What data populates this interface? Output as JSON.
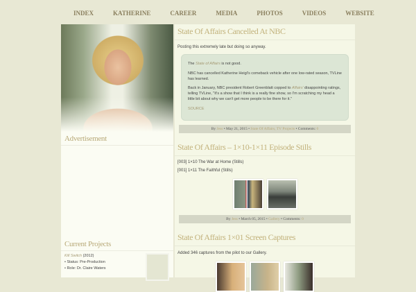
{
  "nav": [
    "INDEX",
    "KATHERINE",
    "CAREER",
    "MEDIA",
    "PHOTOS",
    "VIDEOS",
    "WEBSITE"
  ],
  "sidebar": {
    "advertisement": "Advertisement",
    "current_projects": "Current Projects",
    "project": {
      "title": "Kill Switch",
      "year": "(2012)",
      "status": "• Status: Pre-Production",
      "role": "• Role: Dr. Claire Waters"
    }
  },
  "posts": [
    {
      "title": "State Of Affairs Cancelled At NBC",
      "intro": "Posting this extremely late but doing so anyway.",
      "quote": {
        "p1a": "The ",
        "p1i": "State of Affairs",
        "p1b": " is not good.",
        "p2": "NBC has cancelled Katherine Heigl's comeback vehicle after one low-rated season, TVLine has learned.",
        "p3a": "Back in January, NBC president Robert Greenblatt copped to ",
        "p3i": "Affairs'",
        "p3b": " disappointing ratings, telling TVLine, \"It's a show that I think is a really fine show, so I'm scratching my head a little bit about why we can't get more people to be there for it.\"",
        "source": "SOURCE"
      },
      "meta": {
        "by": "By ",
        "author": "Jess",
        "date": " • May 21, 2015 • ",
        "cats": "State Of Affairs, TV Projects",
        "comments": " • Comments: ",
        "count": "0"
      }
    },
    {
      "title": "State Of Affairs – 1×10-1×11 Episode Stills",
      "lines": [
        "[003] 1×10 The War at Home (Stills)",
        "[001] 1×11 The Faithful (Stills)"
      ],
      "meta": {
        "by": "By ",
        "author": "Jess",
        "date": " • March 05, 2015 • ",
        "cats": "Gallery",
        "comments": " • Comments: ",
        "count": "0"
      }
    },
    {
      "title": "State Of Affairs 1×01 Screen Captures",
      "intro": "Added 346 captures from the pilot to our Gallery."
    }
  ]
}
